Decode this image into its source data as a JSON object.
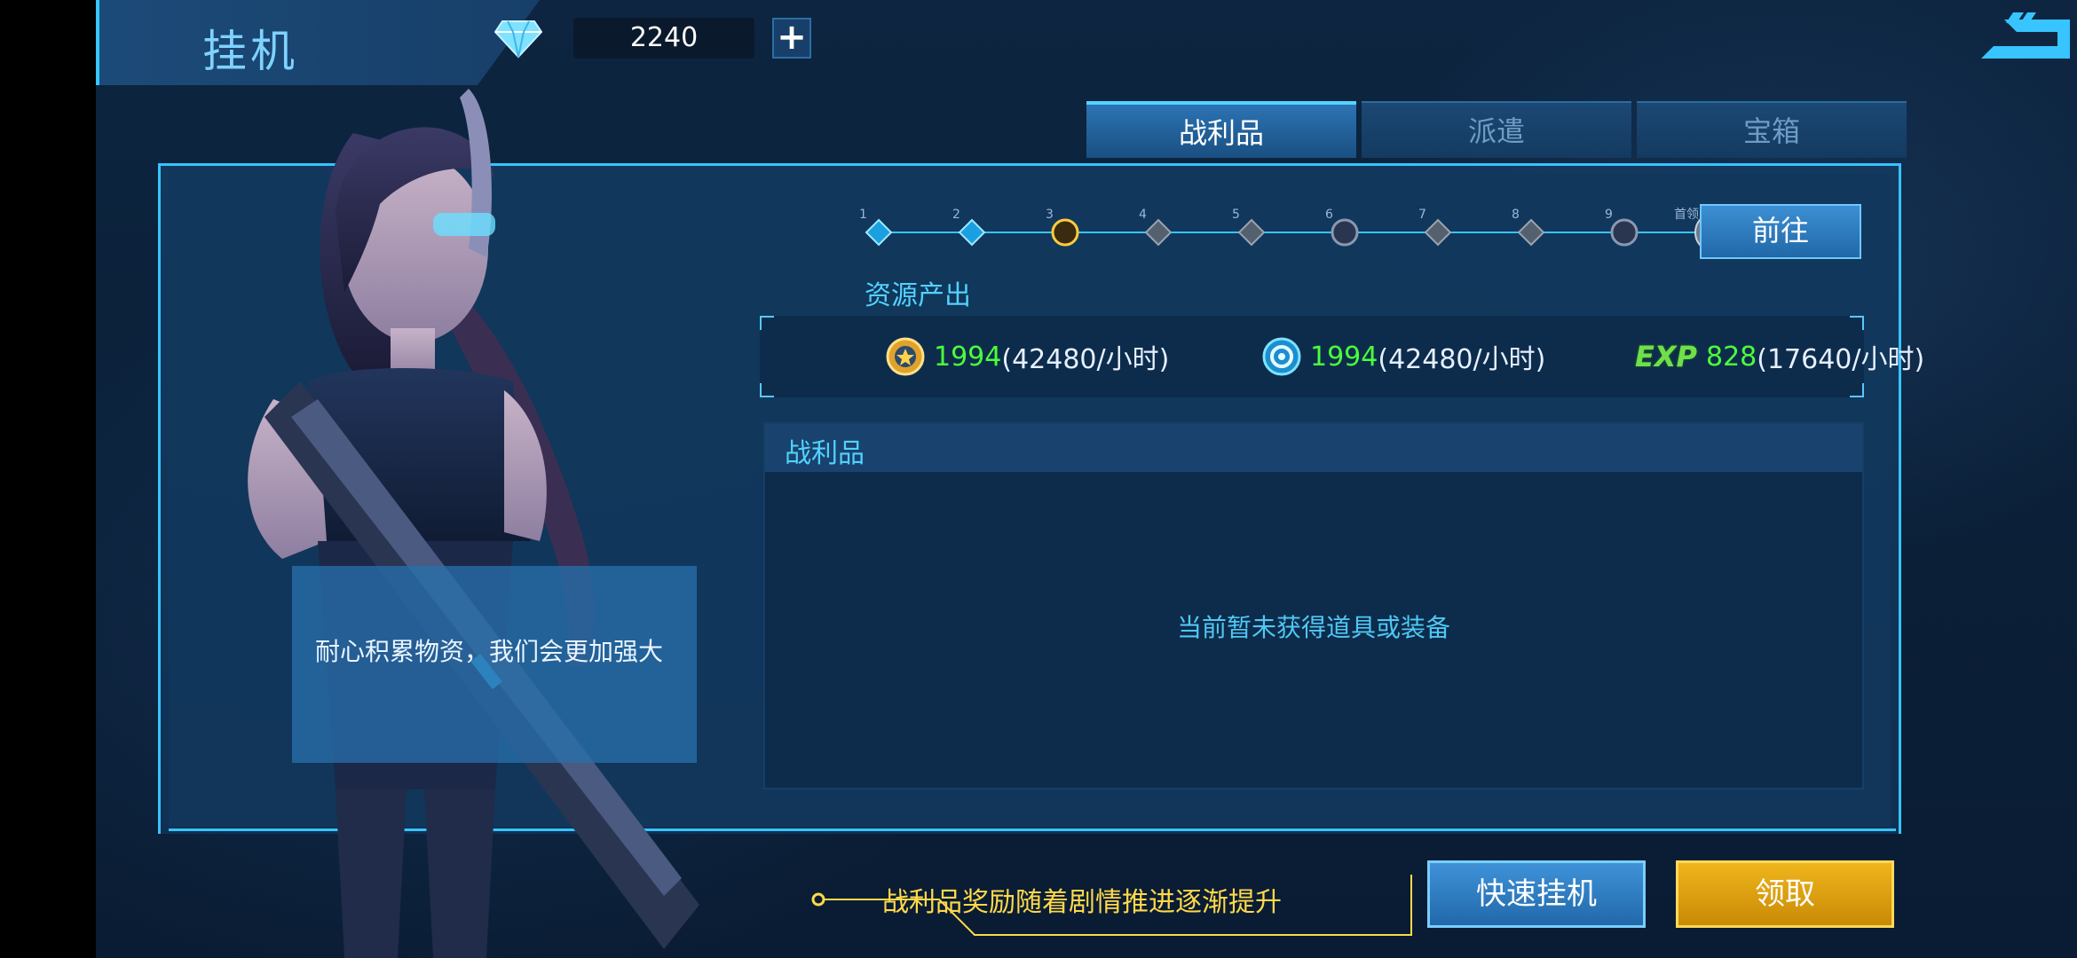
{
  "header": {
    "title": "挂机",
    "gem_count": "2240",
    "add_label": "+"
  },
  "tabs": [
    {
      "label": "战利品",
      "active": true
    },
    {
      "label": "派遣",
      "active": false
    },
    {
      "label": "宝箱",
      "active": false
    }
  ],
  "progress": {
    "nodes": [
      "1",
      "2",
      "3",
      "4",
      "5",
      "6",
      "7",
      "8",
      "9"
    ],
    "boss_label": "首领",
    "go_label": "前往"
  },
  "resources": {
    "section_label": "资源产出",
    "items": [
      {
        "icon": "gold-coin-icon",
        "value": "1994",
        "rate": "(42480/小时)"
      },
      {
        "icon": "blue-core-icon",
        "value": "1994",
        "rate": "(42480/小时)"
      },
      {
        "icon": "exp-icon",
        "icon_text": "EXP",
        "value": "828",
        "rate": "(17640/小时)"
      }
    ]
  },
  "loot": {
    "title": "战利品",
    "empty_message": "当前暂未获得道具或装备"
  },
  "bubble": {
    "text": "耐心积累物资，我们会更加强大"
  },
  "hint": {
    "text": "战利品奖励随着剧情推进逐渐提升"
  },
  "buttons": {
    "quick_idle": "快速挂机",
    "claim": "领取"
  },
  "colors": {
    "accent": "#37c4ff",
    "value_green": "#4bff3a",
    "hint_yellow": "#ffd94a",
    "claim_gold": "#e0a010"
  }
}
